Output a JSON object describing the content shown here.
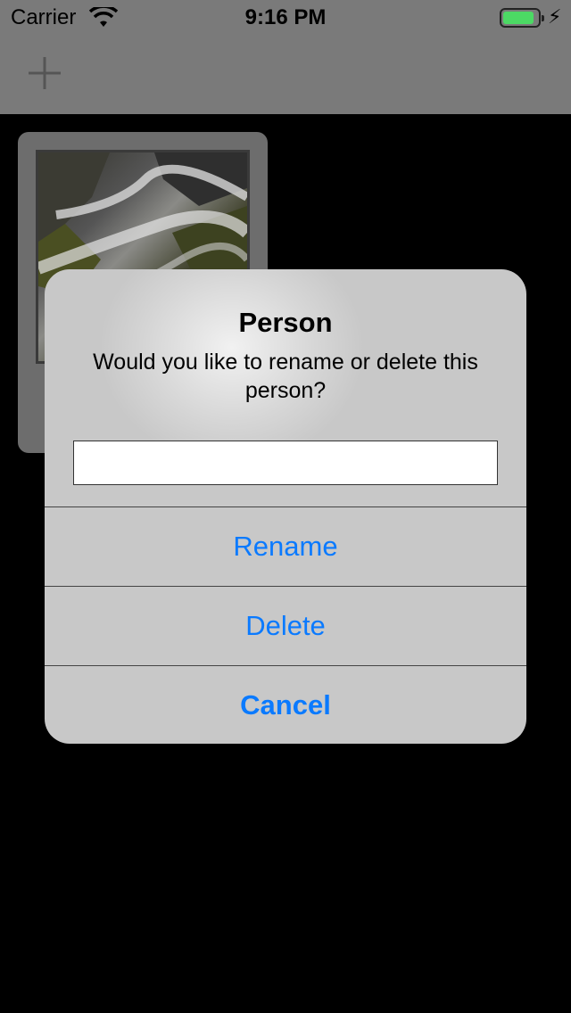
{
  "status_bar": {
    "carrier": "Carrier",
    "time": "9:16 PM",
    "battery_color": "#4cd964",
    "charging_glyph": "⚡"
  },
  "nav_bar": {
    "add_icon": "plus-icon"
  },
  "content": {
    "photo_icon": "waterfall-photo"
  },
  "alert": {
    "title": "Person",
    "message": "Would you like to rename or delete this person?",
    "input_value": "",
    "input_placeholder": "",
    "actions": {
      "rename": "Rename",
      "delete": "Delete",
      "cancel": "Cancel"
    },
    "action_color": "#0a7aff"
  }
}
